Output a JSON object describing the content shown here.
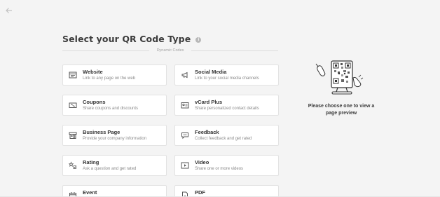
{
  "header": {
    "title": "Select your QR Code Type",
    "info_glyph": "i",
    "section_label": "Dynamic Codes"
  },
  "cards": [
    {
      "id": "website",
      "icon": "website-icon",
      "name": "Website",
      "desc": "Link to any page on the web"
    },
    {
      "id": "social-media",
      "icon": "megaphone-icon",
      "name": "Social Media",
      "desc": "Link to your social media channels"
    },
    {
      "id": "coupons",
      "icon": "coupon-icon",
      "name": "Coupons",
      "desc": "Share coupons and discounts"
    },
    {
      "id": "vcard-plus",
      "icon": "contact-card-icon",
      "name": "vCard Plus",
      "desc": "Share personalized contact details"
    },
    {
      "id": "business-page",
      "icon": "storefront-icon",
      "name": "Business Page",
      "desc": "Provide your company information"
    },
    {
      "id": "feedback",
      "icon": "chat-bubble-icon",
      "name": "Feedback",
      "desc": "Collect feedback and get rated"
    },
    {
      "id": "rating",
      "icon": "rating-icon",
      "name": "Rating",
      "desc": "Ask a question and get rated"
    },
    {
      "id": "video",
      "icon": "video-icon",
      "name": "Video",
      "desc": "Share one or more videos"
    },
    {
      "id": "event",
      "icon": "calendar-icon",
      "name": "Event",
      "desc": ""
    },
    {
      "id": "pdf",
      "icon": "pdf-icon",
      "name": "PDF",
      "desc": ""
    }
  ],
  "preview": {
    "illustration": "qr-code-character-illustration",
    "text": "Please choose one to view a page preview"
  },
  "colors": {
    "background": "#f4f4f4",
    "card": "#ffffff",
    "border": "#e3e3e3",
    "text": "#3a3a3a",
    "muted": "#8a8a8a"
  }
}
